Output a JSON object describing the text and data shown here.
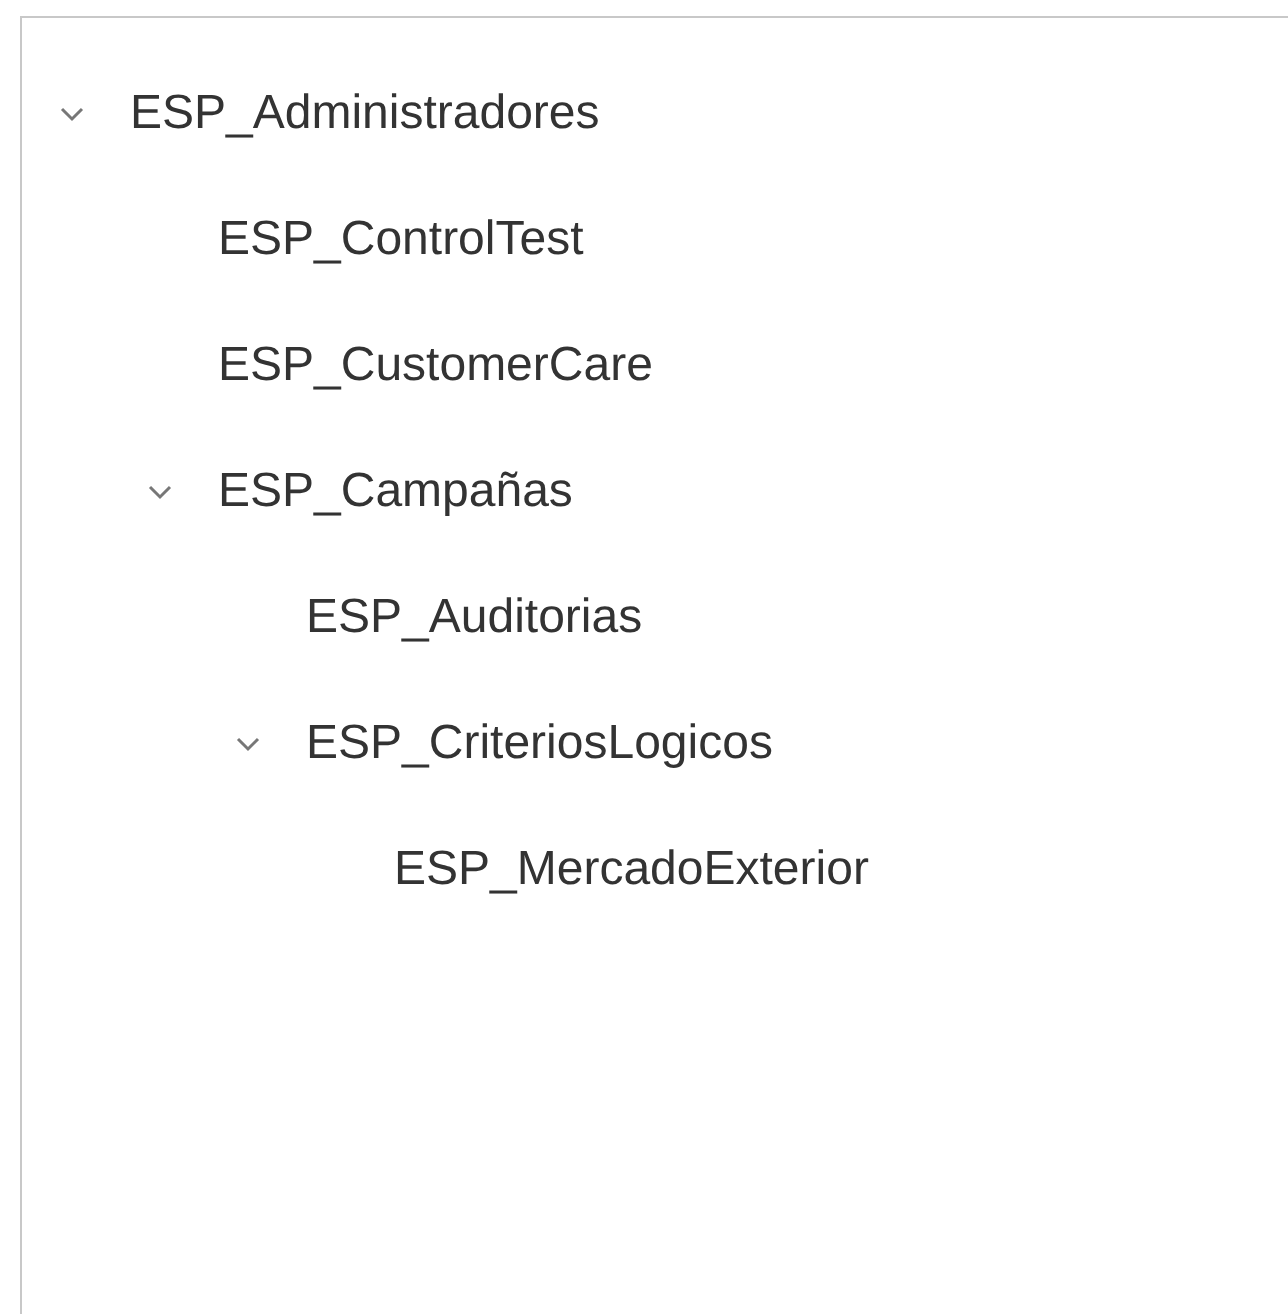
{
  "tree": [
    {
      "label": "ESP_Administradores",
      "expanded": true,
      "children": [
        {
          "label": "ESP_ControlTest"
        },
        {
          "label": "ESP_CustomerCare"
        },
        {
          "label": "ESP_Campañas",
          "expanded": true,
          "children": [
            {
              "label": "ESP_Auditorias"
            },
            {
              "label": "ESP_CriteriosLogicos",
              "expanded": true,
              "children": [
                {
                  "label": "ESP_MercadoExterior"
                }
              ]
            }
          ]
        }
      ]
    }
  ]
}
